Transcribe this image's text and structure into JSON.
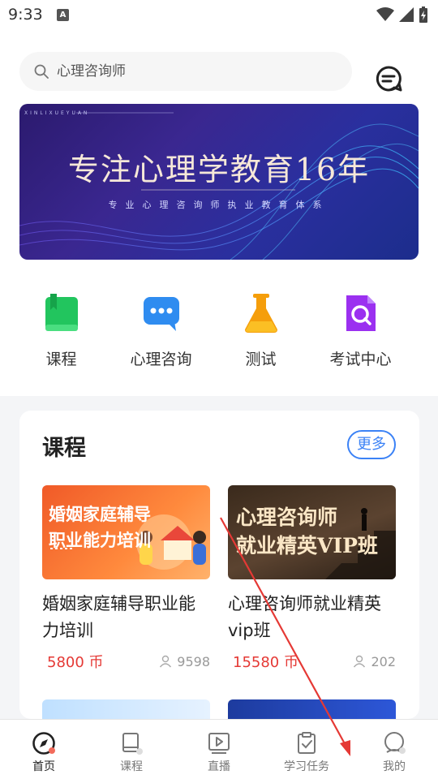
{
  "status": {
    "time": "9:33",
    "notif_letter": "A"
  },
  "search": {
    "placeholder": "心理咨询师"
  },
  "banner": {
    "mini_text": "XINLIXUEYUAN",
    "title": "专注心理学教育16年",
    "subtitle": "专业心理咨询师执业教育体系"
  },
  "quicknav": [
    {
      "label": "课程",
      "icon": "book-icon",
      "color": "#22c55e"
    },
    {
      "label": "心理咨询",
      "icon": "chat-bubble-icon",
      "color": "#2f8cf0"
    },
    {
      "label": "测试",
      "icon": "flask-icon",
      "color": "#f59e0b"
    },
    {
      "label": "考试中心",
      "icon": "exam-search-icon",
      "color": "#9b30f0"
    }
  ],
  "courses_section": {
    "title": "课程",
    "more_label": "更多",
    "items": [
      {
        "image_text_1": "婚姻家庭辅导",
        "image_text_2": "职业能力培训",
        "name": "婚姻家庭辅导职业能力培训",
        "price": "5800 币",
        "students": "9598"
      },
      {
        "image_text_1": "心理咨询师",
        "image_text_2": "就业精英VIP班",
        "name": "心理咨询师就业精英vip班",
        "price": "15580 币",
        "students": "202"
      }
    ]
  },
  "tabbar": [
    {
      "label": "首页",
      "icon": "compass-icon",
      "active": true
    },
    {
      "label": "课程",
      "icon": "course-book-icon",
      "active": false
    },
    {
      "label": "直播",
      "icon": "live-play-icon",
      "active": false
    },
    {
      "label": "学习任务",
      "icon": "clipboard-check-icon",
      "active": false
    },
    {
      "label": "我的",
      "icon": "profile-icon",
      "active": false
    }
  ],
  "colors": {
    "accent_blue": "#3b82f6",
    "price_red": "#e53935"
  }
}
